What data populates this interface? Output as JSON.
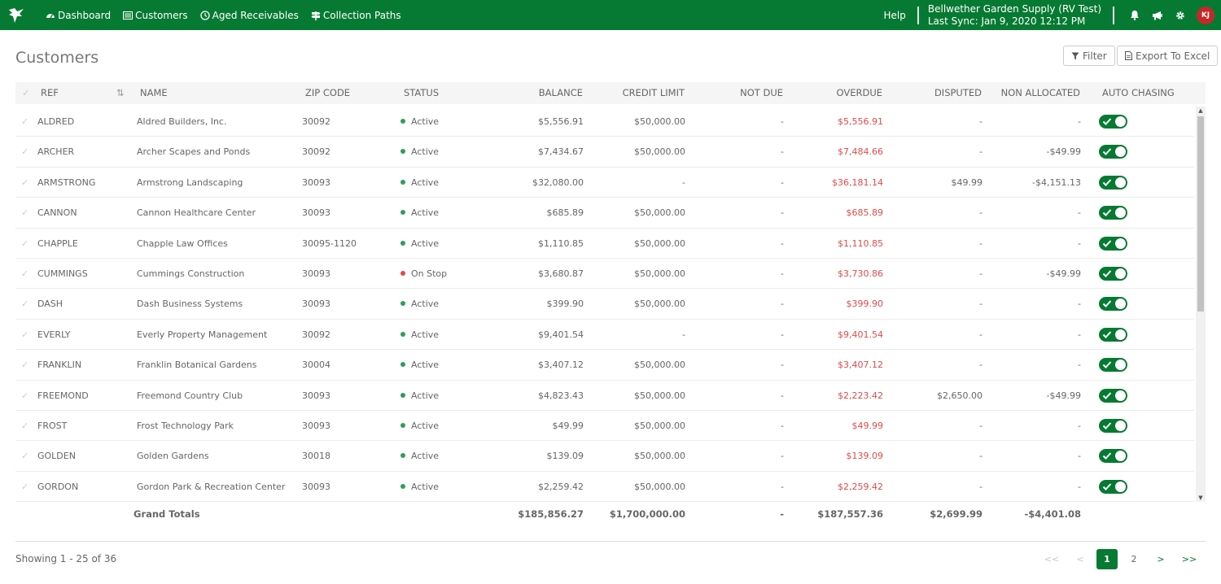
{
  "topbar": {
    "nav": [
      {
        "icon": "dashboard-icon",
        "label": "Dashboard"
      },
      {
        "icon": "list-icon",
        "label": "Customers"
      },
      {
        "icon": "clock-icon",
        "label": "Aged Receivables"
      },
      {
        "icon": "signpost-icon",
        "label": "Collection Paths"
      }
    ],
    "help_label": "Help",
    "company_name": "Bellwether Garden Supply (RV Test)",
    "last_sync": "Last Sync: Jan 9, 2020 12:12 PM",
    "avatar_initials": "KJ",
    "colors": {
      "brand": "#067a32",
      "avatar": "#c62828"
    }
  },
  "page": {
    "title": "Customers",
    "filter_label": "Filter",
    "export_label": "Export To Excel"
  },
  "table": {
    "columns": {
      "ref": "REF",
      "name": "NAME",
      "zip": "ZIP CODE",
      "status": "STATUS",
      "balance": "BALANCE",
      "credit_limit": "CREDIT LIMIT",
      "not_due": "NOT DUE",
      "overdue": "OVERDUE",
      "disputed": "DISPUTED",
      "non_allocated": "NON ALLOCATED",
      "auto_chasing": "AUTO CHASING"
    },
    "rows": [
      {
        "ref": "ALDRED",
        "name": "Aldred Builders, Inc.",
        "zip": "30092",
        "status": "Active",
        "balance": "$5,556.91",
        "credit_limit": "$50,000.00",
        "not_due": "-",
        "overdue": "$5,556.91",
        "disputed": "-",
        "non_allocated": "-"
      },
      {
        "ref": "ARCHER",
        "name": "Archer Scapes and Ponds",
        "zip": "30092",
        "status": "Active",
        "balance": "$7,434.67",
        "credit_limit": "$50,000.00",
        "not_due": "-",
        "overdue": "$7,484.66",
        "disputed": "-",
        "non_allocated": "-$49.99"
      },
      {
        "ref": "ARMSTRONG",
        "name": "Armstrong Landscaping",
        "zip": "30093",
        "status": "Active",
        "balance": "$32,080.00",
        "credit_limit": "-",
        "not_due": "-",
        "overdue": "$36,181.14",
        "disputed": "$49.99",
        "non_allocated": "-$4,151.13"
      },
      {
        "ref": "CANNON",
        "name": "Cannon Healthcare Center",
        "zip": "30093",
        "status": "Active",
        "balance": "$685.89",
        "credit_limit": "$50,000.00",
        "not_due": "-",
        "overdue": "$685.89",
        "disputed": "-",
        "non_allocated": "-"
      },
      {
        "ref": "CHAPPLE",
        "name": "Chapple Law Offices",
        "zip": "30095-1120",
        "status": "Active",
        "balance": "$1,110.85",
        "credit_limit": "$50,000.00",
        "not_due": "-",
        "overdue": "$1,110.85",
        "disputed": "-",
        "non_allocated": "-"
      },
      {
        "ref": "CUMMINGS",
        "name": "Cummings Construction",
        "zip": "30093",
        "status": "On Stop",
        "balance": "$3,680.87",
        "credit_limit": "$50,000.00",
        "not_due": "-",
        "overdue": "$3,730.86",
        "disputed": "-",
        "non_allocated": "-$49.99"
      },
      {
        "ref": "DASH",
        "name": "Dash Business Systems",
        "zip": "30093",
        "status": "Active",
        "balance": "$399.90",
        "credit_limit": "$50,000.00",
        "not_due": "-",
        "overdue": "$399.90",
        "disputed": "-",
        "non_allocated": "-"
      },
      {
        "ref": "EVERLY",
        "name": "Everly Property Management",
        "zip": "30092",
        "status": "Active",
        "balance": "$9,401.54",
        "credit_limit": "-",
        "not_due": "-",
        "overdue": "$9,401.54",
        "disputed": "-",
        "non_allocated": "-"
      },
      {
        "ref": "FRANKLIN",
        "name": "Franklin Botanical Gardens",
        "zip": "30004",
        "status": "Active",
        "balance": "$3,407.12",
        "credit_limit": "$50,000.00",
        "not_due": "-",
        "overdue": "$3,407.12",
        "disputed": "-",
        "non_allocated": "-"
      },
      {
        "ref": "FREEMOND",
        "name": "Freemond Country Club",
        "zip": "30093",
        "status": "Active",
        "balance": "$4,823.43",
        "credit_limit": "$50,000.00",
        "not_due": "-",
        "overdue": "$2,223.42",
        "disputed": "$2,650.00",
        "non_allocated": "-$49.99"
      },
      {
        "ref": "FROST",
        "name": "Frost Technology Park",
        "zip": "30093",
        "status": "Active",
        "balance": "$49.99",
        "credit_limit": "$50,000.00",
        "not_due": "-",
        "overdue": "$49.99",
        "disputed": "-",
        "non_allocated": "-"
      },
      {
        "ref": "GOLDEN",
        "name": "Golden Gardens",
        "zip": "30018",
        "status": "Active",
        "balance": "$139.09",
        "credit_limit": "$50,000.00",
        "not_due": "-",
        "overdue": "$139.09",
        "disputed": "-",
        "non_allocated": "-"
      },
      {
        "ref": "GORDON",
        "name": "Gordon Park & Recreation Center",
        "zip": "30093",
        "status": "Active",
        "balance": "$2,259.42",
        "credit_limit": "$50,000.00",
        "not_due": "-",
        "overdue": "$2,259.42",
        "disputed": "-",
        "non_allocated": "-"
      }
    ],
    "totals": {
      "label": "Grand Totals",
      "balance": "$185,856.27",
      "credit_limit": "$1,700,000.00",
      "not_due": "-",
      "overdue": "$187,557.36",
      "disputed": "$2,699.99",
      "non_allocated": "-$4,401.08"
    },
    "status_colors": {
      "Active": "#2e9e5a",
      "On Stop": "#e04a4a"
    }
  },
  "pagination": {
    "showing_label": "Showing",
    "range": "1 - 25",
    "of_label": "of",
    "total": "36",
    "first": "<<",
    "prev": "<",
    "pages": [
      "1",
      "2"
    ],
    "next": ">",
    "last": ">>"
  }
}
